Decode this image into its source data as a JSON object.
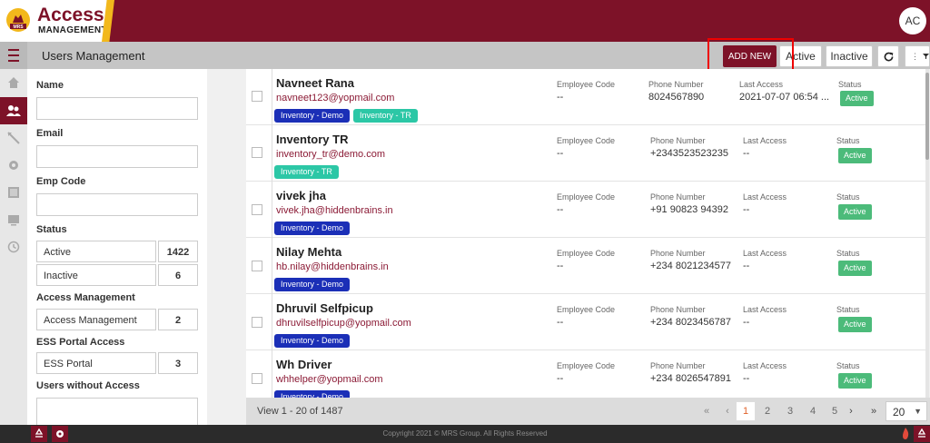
{
  "brand": {
    "title": "Access",
    "subtitle": "MANAGEMENT",
    "emblem_text": "MRS"
  },
  "user": {
    "initials": "AC"
  },
  "header": {
    "title": "Users Management",
    "add_new_label": "ADD NEW",
    "active_label": "Active",
    "inactive_label": "Inactive",
    "filter_dots": "⋮"
  },
  "rail": [
    "home-icon",
    "users-icon",
    "tools-icon",
    "gear-icon",
    "report-icon",
    "monitor-icon",
    "history-icon"
  ],
  "filters": {
    "name_label": "Name",
    "email_label": "Email",
    "empcode_label": "Emp Code",
    "status_label": "Status",
    "status_items": [
      {
        "label": "Active",
        "count": "1422"
      },
      {
        "label": "Inactive",
        "count": "6"
      }
    ],
    "access_label": "Access Management",
    "access_items": [
      {
        "label": "Access Management",
        "count": "2"
      }
    ],
    "ess_label": "ESS Portal Access",
    "ess_items": [
      {
        "label": "ESS Portal",
        "count": "3"
      }
    ],
    "without_label": "Users without Access"
  },
  "columns": {
    "emp_code": "Employee Code",
    "phone": "Phone Number",
    "last_access": "Last Access",
    "status": "Status"
  },
  "users": [
    {
      "name": "Navneet Rana",
      "email": "navneet123@yopmail.com",
      "emp_code": "--",
      "phone": "8024567890",
      "last_access": "2021-07-07 06:54 ...",
      "status": "Active",
      "tags": [
        {
          "label": "Inventory - Demo",
          "kind": "demo"
        },
        {
          "label": "Inventory - TR",
          "kind": "tr"
        }
      ]
    },
    {
      "name": "Inventory TR",
      "email": "inventory_tr@demo.com",
      "emp_code": "--",
      "phone": "+2343523523235",
      "last_access": "--",
      "status": "Active",
      "tags": [
        {
          "label": "Inventory - TR",
          "kind": "tr"
        }
      ]
    },
    {
      "name": "vivek jha",
      "email": "vivek.jha@hiddenbrains.in",
      "emp_code": "--",
      "phone": "+91 90823 94392",
      "last_access": "--",
      "status": "Active",
      "tags": [
        {
          "label": "Inventory - Demo",
          "kind": "demo"
        }
      ]
    },
    {
      "name": "Nilay Mehta",
      "email": "hb.nilay@hiddenbrains.in",
      "emp_code": "--",
      "phone": "+234 8021234577",
      "last_access": "--",
      "status": "Active",
      "tags": [
        {
          "label": "Inventory - Demo",
          "kind": "demo"
        }
      ]
    },
    {
      "name": "Dhruvil Selfpicup",
      "email": "dhruvilselfpicup@yopmail.com",
      "emp_code": "--",
      "phone": "+234 8023456787",
      "last_access": "--",
      "status": "Active",
      "tags": [
        {
          "label": "Inventory - Demo",
          "kind": "demo"
        }
      ]
    },
    {
      "name": "Wh Driver",
      "email": "whhelper@yopmail.com",
      "emp_code": "--",
      "phone": "+234 8026547891",
      "last_access": "--",
      "status": "Active",
      "tags": [
        {
          "label": "Inventory - Demo",
          "kind": "demo"
        }
      ]
    }
  ],
  "pager": {
    "info": "View 1 - 20 of 1487",
    "first": "«",
    "prev": "‹",
    "pages": [
      "1",
      "2",
      "3",
      "4",
      "5"
    ],
    "current": "1",
    "next": "›",
    "last": "»",
    "per_page": "20"
  },
  "footer": {
    "copyright": "Copyright 2021 © MRS Group. All Rights Reserved"
  },
  "colors": {
    "brand": "#7d1228",
    "accent": "#f2b81c",
    "tag_demo": "#1b2fb7",
    "tag_tr": "#2cc7a6",
    "status_active": "#4cbb7a"
  }
}
